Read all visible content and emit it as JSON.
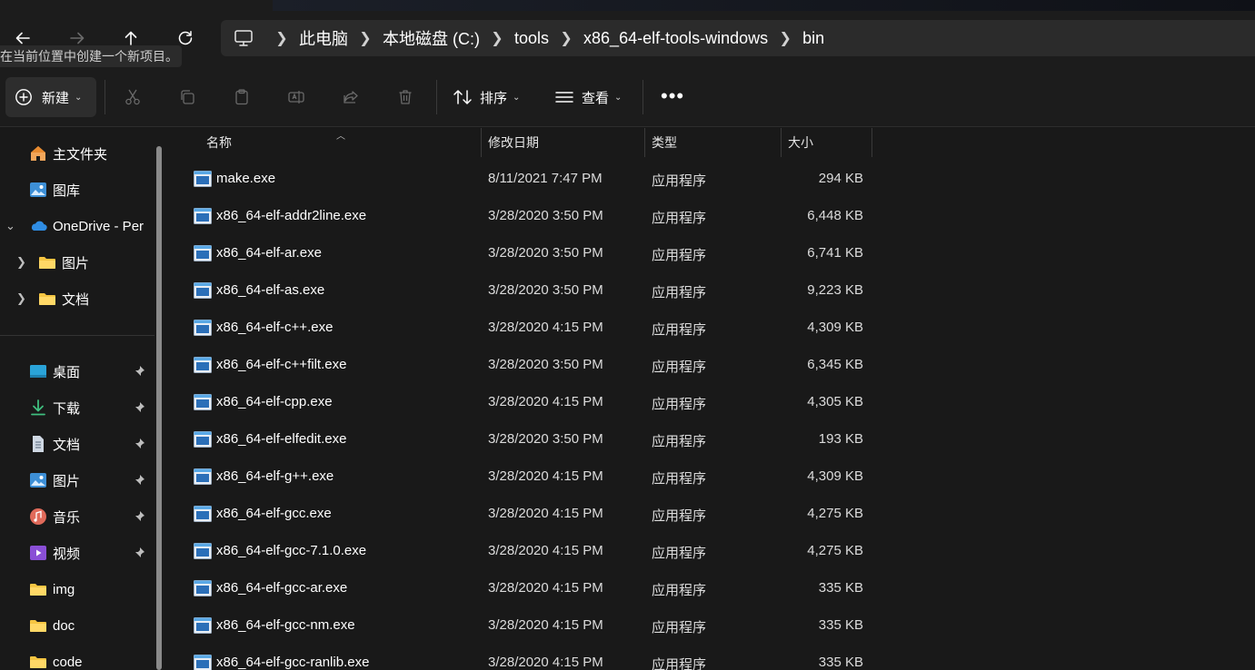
{
  "tooltip": "在当前位置中创建一个新项目。",
  "nav": {
    "back_icon": "arrow-left-icon",
    "forward_icon": "arrow-right-icon",
    "up_icon": "arrow-up-icon",
    "refresh_icon": "refresh-icon"
  },
  "breadcrumb": [
    "此电脑",
    "本地磁盘 (C:)",
    "tools",
    "x86_64-elf-tools-windows",
    "bin"
  ],
  "toolbar": {
    "new_label": "新建",
    "sort_label": "排序",
    "view_label": "查看",
    "more_label": "•••"
  },
  "sidebar": {
    "home": "主文件夹",
    "gallery": "图库",
    "onedrive": "OneDrive - Per",
    "od_pictures": "图片",
    "od_documents": "文档",
    "desktop": "桌面",
    "downloads": "下载",
    "documents": "文档",
    "pictures": "图片",
    "music": "音乐",
    "videos": "视频",
    "img": "img",
    "doc": "doc",
    "code": "code"
  },
  "columns": {
    "name": "名称",
    "modified": "修改日期",
    "type": "类型",
    "size": "大小"
  },
  "files": [
    {
      "name": "make.exe",
      "date": "8/11/2021 7:47 PM",
      "type": "应用程序",
      "size": "294 KB"
    },
    {
      "name": "x86_64-elf-addr2line.exe",
      "date": "3/28/2020 3:50 PM",
      "type": "应用程序",
      "size": "6,448 KB"
    },
    {
      "name": "x86_64-elf-ar.exe",
      "date": "3/28/2020 3:50 PM",
      "type": "应用程序",
      "size": "6,741 KB"
    },
    {
      "name": "x86_64-elf-as.exe",
      "date": "3/28/2020 3:50 PM",
      "type": "应用程序",
      "size": "9,223 KB"
    },
    {
      "name": "x86_64-elf-c++.exe",
      "date": "3/28/2020 4:15 PM",
      "type": "应用程序",
      "size": "4,309 KB"
    },
    {
      "name": "x86_64-elf-c++filt.exe",
      "date": "3/28/2020 3:50 PM",
      "type": "应用程序",
      "size": "6,345 KB"
    },
    {
      "name": "x86_64-elf-cpp.exe",
      "date": "3/28/2020 4:15 PM",
      "type": "应用程序",
      "size": "4,305 KB"
    },
    {
      "name": "x86_64-elf-elfedit.exe",
      "date": "3/28/2020 3:50 PM",
      "type": "应用程序",
      "size": "193 KB"
    },
    {
      "name": "x86_64-elf-g++.exe",
      "date": "3/28/2020 4:15 PM",
      "type": "应用程序",
      "size": "4,309 KB"
    },
    {
      "name": "x86_64-elf-gcc.exe",
      "date": "3/28/2020 4:15 PM",
      "type": "应用程序",
      "size": "4,275 KB"
    },
    {
      "name": "x86_64-elf-gcc-7.1.0.exe",
      "date": "3/28/2020 4:15 PM",
      "type": "应用程序",
      "size": "4,275 KB"
    },
    {
      "name": "x86_64-elf-gcc-ar.exe",
      "date": "3/28/2020 4:15 PM",
      "type": "应用程序",
      "size": "335 KB"
    },
    {
      "name": "x86_64-elf-gcc-nm.exe",
      "date": "3/28/2020 4:15 PM",
      "type": "应用程序",
      "size": "335 KB"
    },
    {
      "name": "x86_64-elf-gcc-ranlib.exe",
      "date": "3/28/2020 4:15 PM",
      "type": "应用程序",
      "size": "335 KB"
    }
  ]
}
